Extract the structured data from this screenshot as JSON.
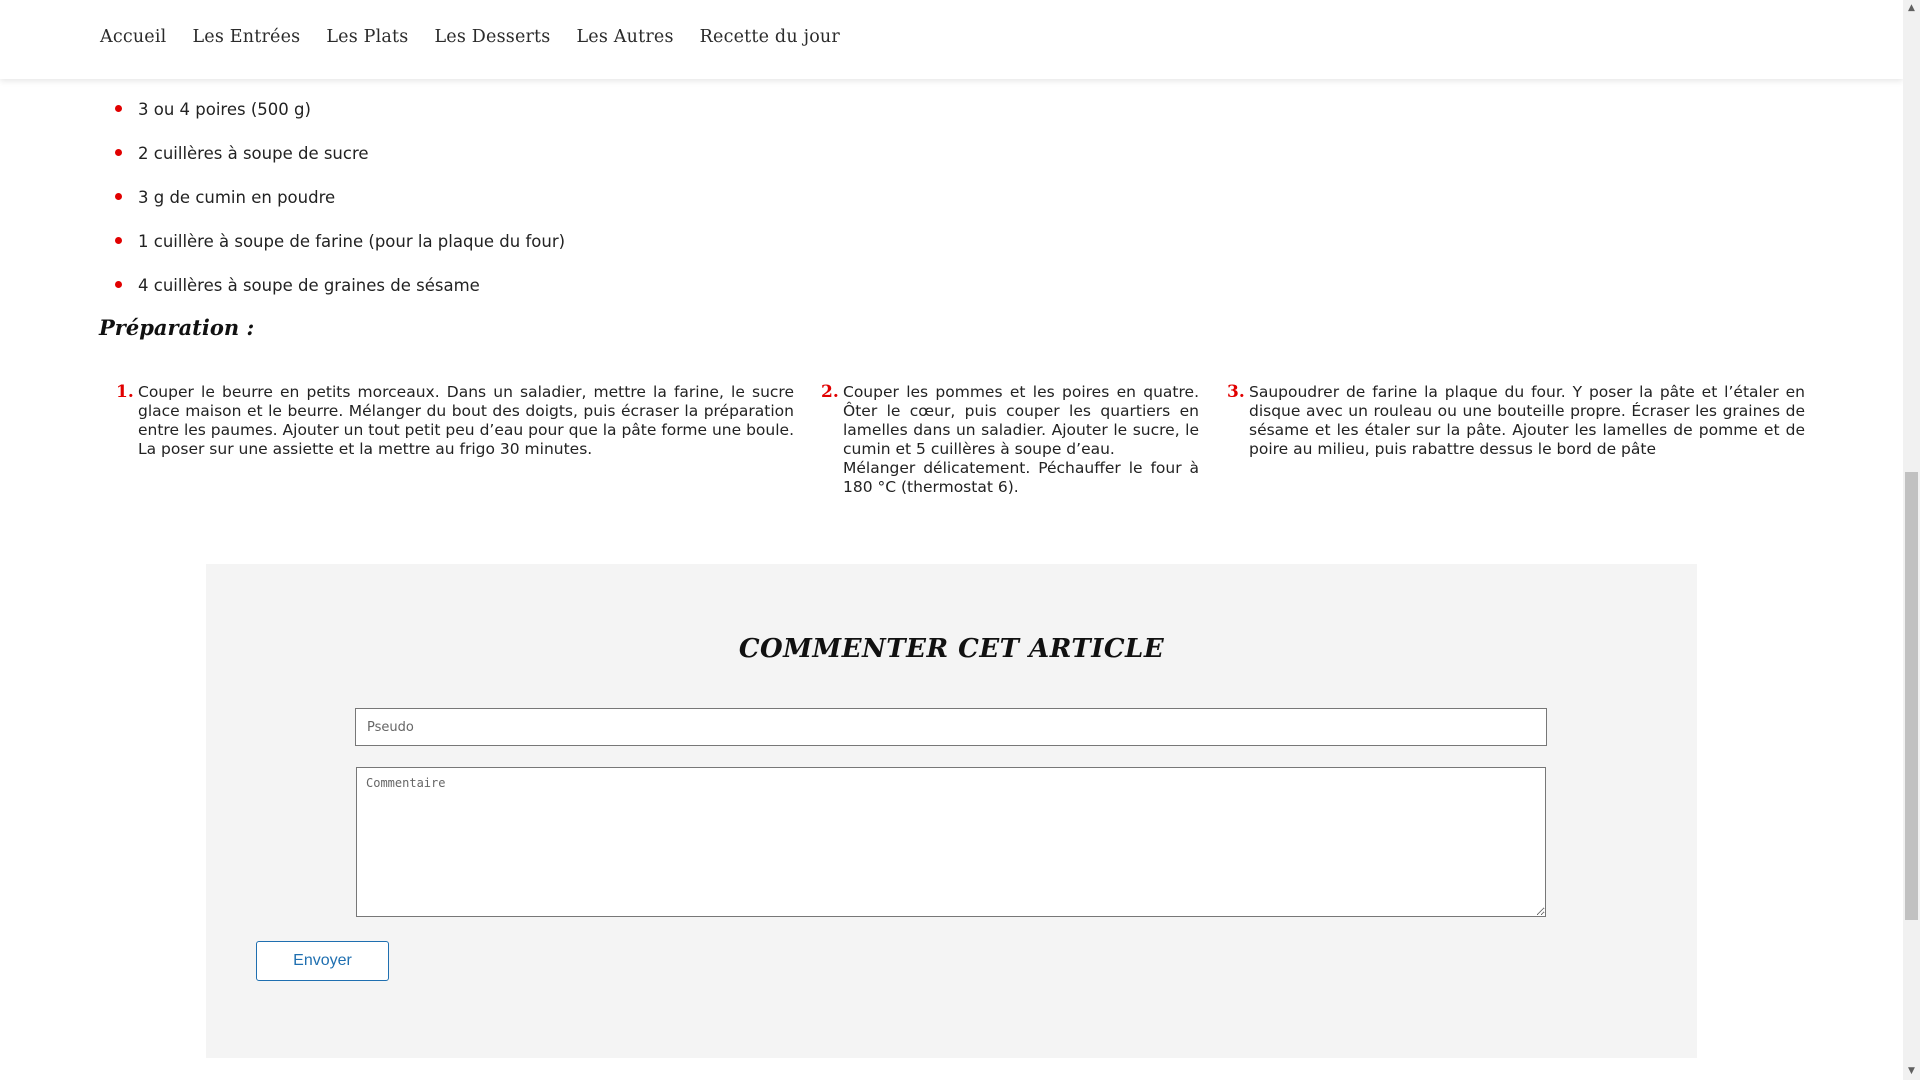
{
  "nav": {
    "items": [
      "Accueil",
      "Les Entrées",
      "Les Plats",
      "Les Desserts",
      "Les Autres",
      "Recette du jour"
    ]
  },
  "ingredients": [
    "3 ou 4 poires (500 g)",
    "2 cuillères à soupe de sucre",
    "3 g de cumin en poudre",
    "1 cuillère à soupe de farine (pour la plaque du four)",
    "4 cuillères à soupe de graines de sésame"
  ],
  "preparation": {
    "title": "Préparation :",
    "steps": [
      {
        "num": "1.",
        "lines": [
          "Couper le beurre en petits morceaux. Dans un saladier, mettre la farine, le sucre glace maison et le beurre. Mélanger du bout des doigts, puis écraser la préparation entre les paumes. Ajouter un tout petit peu d’eau pour que la pâte forme une boule. La poser sur une assiette et la mettre au frigo 30 minutes."
        ]
      },
      {
        "num": "2.",
        "lines": [
          "Couper les pommes et les poires en quatre. Ôter le cœur, puis couper les quartiers en lamelles dans un saladier. Ajouter le sucre, le cumin et 5 cuillères à soupe d’eau.",
          "Mélanger délicatement. Péchauffer le four à 180 °C (thermostat 6)."
        ]
      },
      {
        "num": "3.",
        "lines": [
          "Saupoudrer de farine la plaque du four. Y poser la pâte et l’étaler en disque avec un rouleau ou une bouteille propre. Écraser les graines de sésame et les étaler sur la pâte. Ajouter les lamelles de pomme et de poire au milieu, puis rabattre dessus le bord de pâte"
        ]
      }
    ]
  },
  "comment": {
    "title": "COMMENTER CET ARTICLE",
    "pseudo_placeholder": "Pseudo",
    "commentaire_placeholder": "Commentaire",
    "send_label": "Envoyer"
  },
  "colors": {
    "accent": "#e10000",
    "button": "#1f6fb0",
    "panel": "#f4f4f4"
  }
}
